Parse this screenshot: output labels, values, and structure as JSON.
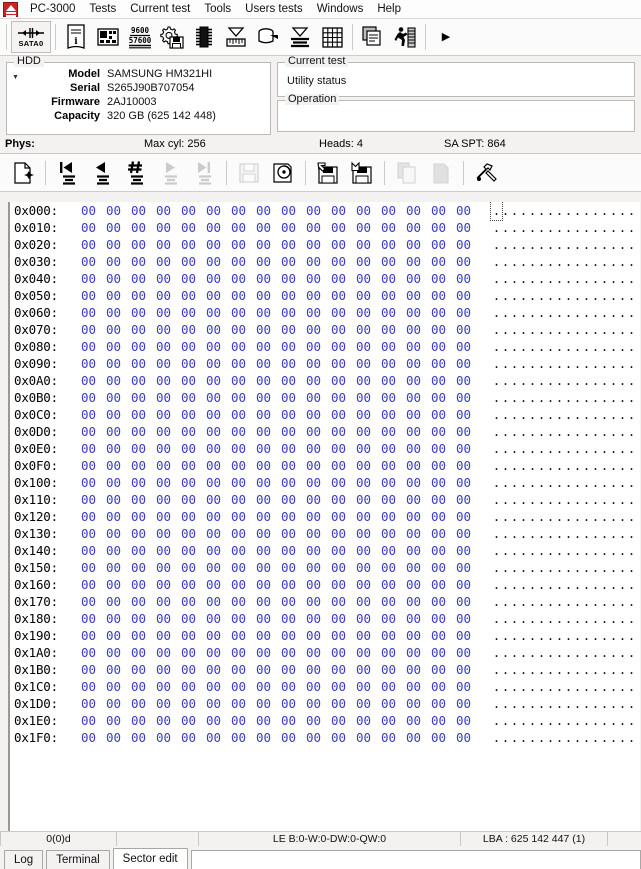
{
  "app": {
    "title": "PC-3000",
    "logo_icon": "pc3000-logo-icon"
  },
  "menubar": {
    "items": [
      {
        "label": "Tests"
      },
      {
        "label": "Current test"
      },
      {
        "label": "Tools"
      },
      {
        "label": "Users tests"
      },
      {
        "label": "Windows"
      },
      {
        "label": "Help"
      }
    ]
  },
  "toolbar": {
    "sata_label": "SATA0",
    "overflow_label": "▶",
    "items": [
      {
        "name": "sata0-port-button",
        "label": "SATA0"
      },
      {
        "name": "drive-info-button",
        "label": ""
      },
      {
        "name": "drive-config-button",
        "label": ""
      },
      {
        "name": "baudrate-button",
        "label": "9600 57600"
      },
      {
        "name": "utility-settings-button",
        "label": ""
      },
      {
        "name": "rom-chip-button",
        "label": ""
      },
      {
        "name": "surface-test-button",
        "label": ""
      },
      {
        "name": "disk-operations-button",
        "label": ""
      },
      {
        "name": "head-map-button",
        "label": ""
      },
      {
        "name": "sector-grid-button",
        "label": ""
      },
      {
        "name": "copy-window-button",
        "label": ""
      },
      {
        "name": "run-task-button",
        "label": ""
      }
    ]
  },
  "hdd": {
    "caption": "HDD",
    "fields": [
      {
        "label": "Model",
        "value": "SAMSUNG HM321HI"
      },
      {
        "label": "Serial",
        "value": "S265J90B707054"
      },
      {
        "label": "Firmware",
        "value": "2AJ10003"
      },
      {
        "label": "Capacity",
        "value": "320 GB (625 142 448)"
      }
    ]
  },
  "current_test": {
    "caption": "Current test",
    "status": "Utility status"
  },
  "operation": {
    "caption": "Operation",
    "text": ""
  },
  "phys": {
    "label": "Phys:",
    "max_cyl_label": "Max cyl: 256",
    "heads_label": "Heads: 4",
    "sa_spt_label": "SA SPT: 864"
  },
  "sector_toolbar": {
    "items": [
      {
        "name": "new-sector-button",
        "enabled": true
      },
      {
        "name": "first-sector-button",
        "enabled": true
      },
      {
        "name": "previous-sector-button",
        "enabled": true
      },
      {
        "name": "goto-sector-button",
        "enabled": true
      },
      {
        "name": "next-sector-button",
        "enabled": false
      },
      {
        "name": "last-sector-button",
        "enabled": false
      },
      {
        "name": "save-sector-button",
        "enabled": false
      },
      {
        "name": "read-sector-button",
        "enabled": true
      },
      {
        "name": "load-from-file-button",
        "enabled": true
      },
      {
        "name": "save-to-file-button",
        "enabled": true
      },
      {
        "name": "copy-button",
        "enabled": false
      },
      {
        "name": "paste-button",
        "enabled": false
      },
      {
        "name": "sector-tools-button",
        "enabled": true
      }
    ]
  },
  "hex_editor": {
    "row_count": 32,
    "bytes_per_row": 16,
    "offset_suffix": ":",
    "byte_value": "00",
    "ascii_char": ".",
    "cursor_row": 0,
    "cursor_col": 0,
    "offsets": [
      "0x000",
      "0x010",
      "0x020",
      "0x030",
      "0x040",
      "0x050",
      "0x060",
      "0x070",
      "0x080",
      "0x090",
      "0x0A0",
      "0x0B0",
      "0x0C0",
      "0x0D0",
      "0x0E0",
      "0x0F0",
      "0x100",
      "0x110",
      "0x120",
      "0x130",
      "0x140",
      "0x150",
      "0x160",
      "0x170",
      "0x180",
      "0x190",
      "0x1A0",
      "0x1B0",
      "0x1C0",
      "0x1D0",
      "0x1E0",
      "0x1F0"
    ]
  },
  "statusbar": {
    "offset": "0(0)d",
    "blank": "",
    "endianness": "LE B:0-W:0-DW:0-QW:0",
    "lba": "LBA : 625 142 447 (1)",
    "extra": ""
  },
  "tabs": {
    "items": [
      {
        "label": "Log",
        "active": false
      },
      {
        "label": "Terminal",
        "active": false
      },
      {
        "label": "Sector edit",
        "active": true
      }
    ]
  },
  "colors": {
    "hex_value": "#3b3bc4",
    "logo_red": "#cf2222",
    "chrome": "#f3f2f1"
  }
}
